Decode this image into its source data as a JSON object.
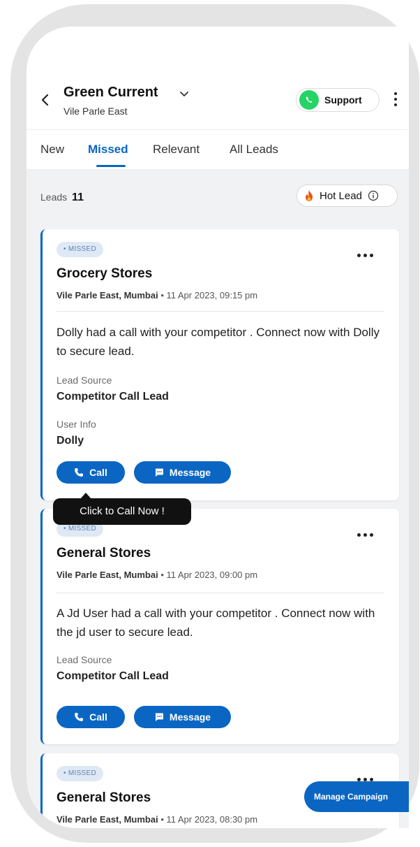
{
  "header": {
    "title": "Green Current",
    "subtitle": "Vile Parle East",
    "support_label": "Support"
  },
  "tabs": [
    {
      "label": "New",
      "active": false
    },
    {
      "label": "Missed",
      "active": true
    },
    {
      "label": "Relevant",
      "active": false
    },
    {
      "label": "All Leads",
      "active": false
    }
  ],
  "leads": {
    "label": "Leads",
    "count": "11",
    "hot_lead_label": "Hot Lead"
  },
  "cards": [
    {
      "badge": "• MISSED",
      "title": "Grocery Stores",
      "location": "Vile Parle East, Mumbai",
      "separator": " • ",
      "datetime": "11 Apr 2023, 09:15 pm",
      "description": "Dolly had a call with your competitor . Connect now with Dolly to secure lead.",
      "lead_source_label": "Lead Source",
      "lead_source": "Competitor Call Lead",
      "user_info_label": "User Info",
      "user_info": "Dolly",
      "call_label": "Call",
      "message_label": "Message"
    },
    {
      "badge": "• MISSED",
      "title": "General Stores",
      "location": "Vile Parle East, Mumbai",
      "separator": " • ",
      "datetime": "11 Apr 2023, 09:00 pm",
      "description": "A Jd User had a call with your competitor . Connect now with the jd user to secure lead.",
      "lead_source_label": "Lead Source",
      "lead_source": "Competitor Call Lead",
      "call_label": "Call",
      "message_label": "Message"
    },
    {
      "badge": "• MISSED",
      "title": "General Stores",
      "location": "Vile Parle East, Mumbai",
      "separator": " • ",
      "datetime": "11 Apr 2023, 08:30 pm"
    }
  ],
  "tooltip": "Click to Call Now !",
  "manage_campaign_label": "Manage Campaign",
  "colors": {
    "accent": "#0a66c2",
    "badge_bg": "#dfe9f5",
    "whatsapp": "#25d366",
    "background": "#f1f2f4"
  },
  "icons": [
    "back-icon",
    "chevron-down-icon",
    "whatsapp-icon",
    "more-vertical-icon",
    "flame-icon",
    "info-icon",
    "more-horizontal-icon",
    "phone-icon",
    "message-icon"
  ]
}
